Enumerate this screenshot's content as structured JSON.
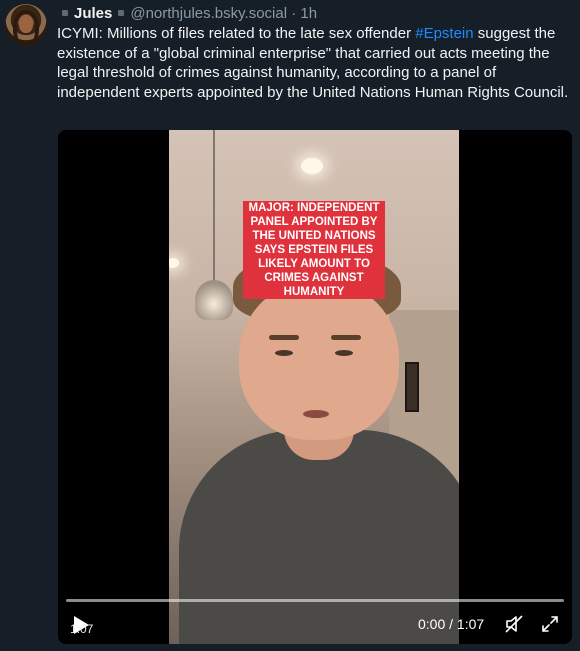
{
  "post": {
    "author_name": "Jules",
    "author_handle": "@northjules.bsky.social",
    "separator": "·",
    "time_ago": "1h",
    "text_before": "ICYMI: Millions of files related to the late sex offender ",
    "hashtag": "#Epstein",
    "text_after": " suggest the existence of a \"global criminal enterprise\" that carried out acts meeting the legal threshold of crimes against humanity, according to a panel of independent experts appointed by the United Nations Human Rights Council."
  },
  "video": {
    "caption": "MAJOR: INDEPENDENT PANEL APPOINTED BY THE UNITED NATIONS SAYS EPSTEIN FILES LIKELY AMOUNT TO CRIMES AGAINST HUMANITY",
    "duration_overlay": "1:07",
    "time_display": "0:00 / 1:07",
    "progress": 0,
    "icons": {
      "play": "play-icon",
      "mute": "muted-speaker-icon",
      "fullscreen": "fullscreen-icon"
    }
  },
  "colors": {
    "background": "#161e27",
    "link": "#208bfe",
    "caption_bg": "#e0323d"
  }
}
